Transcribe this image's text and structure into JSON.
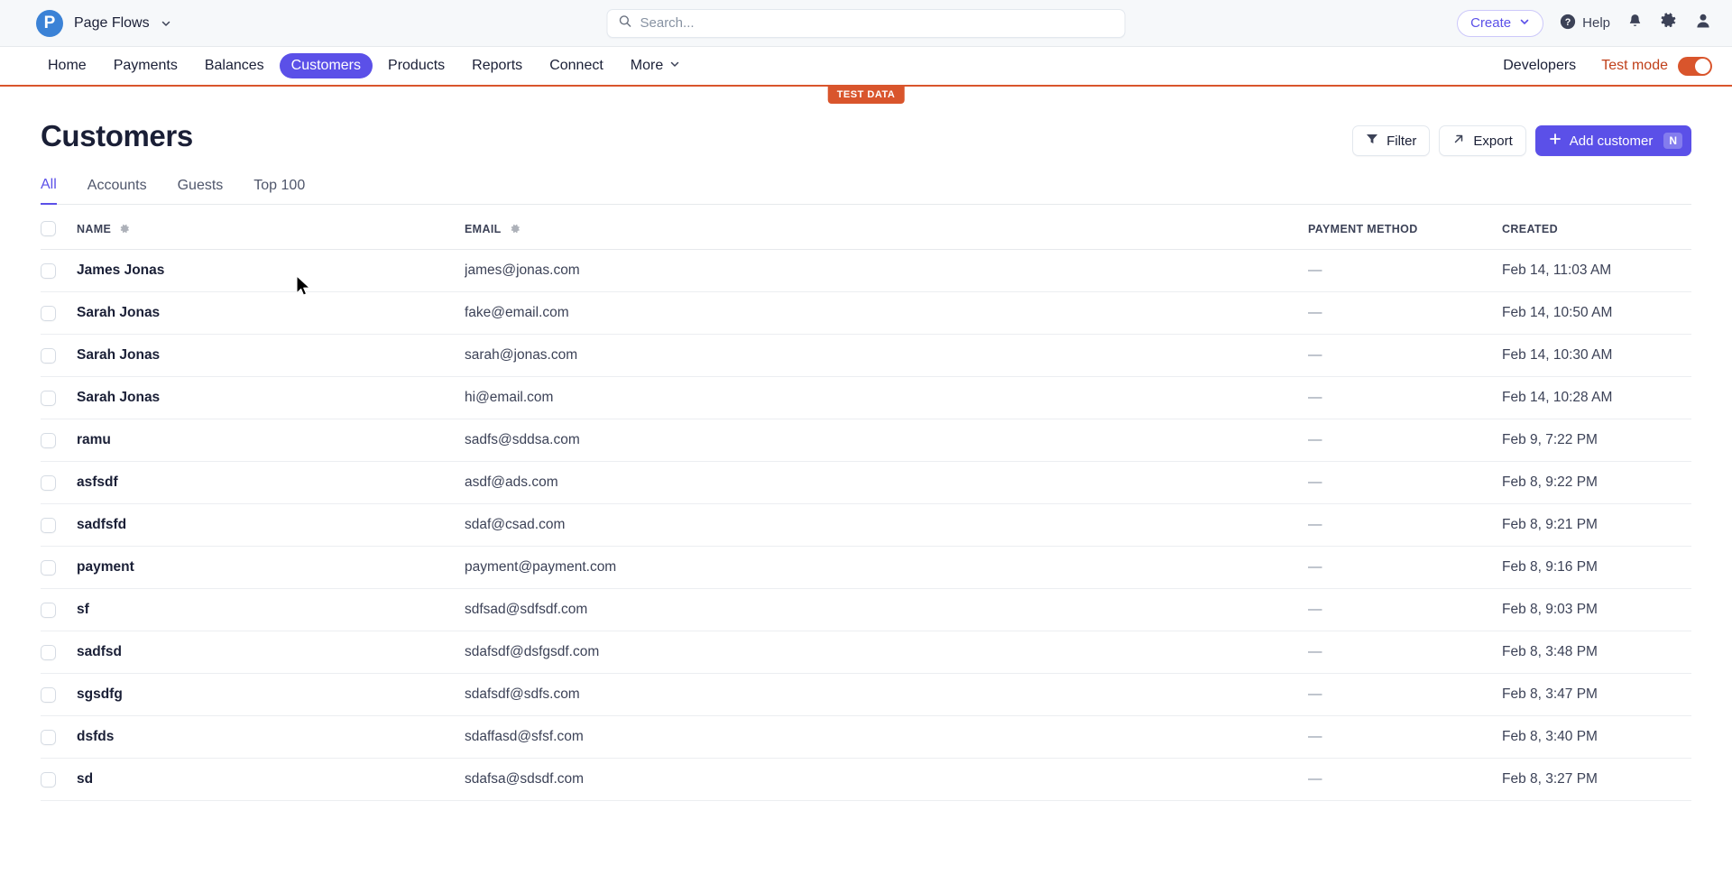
{
  "topbar": {
    "brand_name": "Page Flows",
    "brand_initial": "P",
    "search_placeholder": "Search...",
    "search_value": "",
    "create_label": "Create",
    "help_label": "Help",
    "icons": {
      "search": "search-icon",
      "chevron": "chevron-down-icon",
      "help": "help-circle-icon",
      "notifications": "bell-icon",
      "settings": "gear-icon",
      "account": "user-icon"
    }
  },
  "nav": {
    "items": [
      {
        "label": "Home",
        "active": false,
        "caret": false
      },
      {
        "label": "Payments",
        "active": false,
        "caret": false
      },
      {
        "label": "Balances",
        "active": false,
        "caret": false
      },
      {
        "label": "Customers",
        "active": true,
        "caret": false
      },
      {
        "label": "Products",
        "active": false,
        "caret": false
      },
      {
        "label": "Reports",
        "active": false,
        "caret": false
      },
      {
        "label": "Connect",
        "active": false,
        "caret": false
      },
      {
        "label": "More",
        "active": false,
        "caret": true
      }
    ],
    "developers_label": "Developers",
    "test_mode_label": "Test mode",
    "test_mode_on": true,
    "test_data_badge": "TEST DATA"
  },
  "page": {
    "title": "Customers",
    "filter_label": "Filter",
    "export_label": "Export",
    "add_label": "Add customer",
    "add_shortcut": "N"
  },
  "tabs": [
    {
      "label": "All",
      "active": true
    },
    {
      "label": "Accounts",
      "active": false
    },
    {
      "label": "Guests",
      "active": false
    },
    {
      "label": "Top 100",
      "active": false
    }
  ],
  "table": {
    "columns": [
      {
        "label": "NAME",
        "gear": true
      },
      {
        "label": "EMAIL",
        "gear": true
      },
      {
        "label": "PAYMENT METHOD",
        "gear": false
      },
      {
        "label": "CREATED",
        "gear": false
      }
    ],
    "rows": [
      {
        "name": "James Jonas",
        "email": "james@jonas.com",
        "payment_method": "—",
        "created": "Feb 14, 11:03 AM"
      },
      {
        "name": "Sarah Jonas",
        "email": "fake@email.com",
        "payment_method": "—",
        "created": "Feb 14, 10:50 AM"
      },
      {
        "name": "Sarah Jonas",
        "email": "sarah@jonas.com",
        "payment_method": "—",
        "created": "Feb 14, 10:30 AM"
      },
      {
        "name": "Sarah Jonas",
        "email": "hi@email.com",
        "payment_method": "—",
        "created": "Feb 14, 10:28 AM"
      },
      {
        "name": "ramu",
        "email": "sadfs@sddsa.com",
        "payment_method": "—",
        "created": "Feb 9, 7:22 PM"
      },
      {
        "name": "asfsdf",
        "email": "asdf@ads.com",
        "payment_method": "—",
        "created": "Feb 8, 9:22 PM"
      },
      {
        "name": "sadfsfd",
        "email": "sdaf@csad.com",
        "payment_method": "—",
        "created": "Feb 8, 9:21 PM"
      },
      {
        "name": "payment",
        "email": "payment@payment.com",
        "payment_method": "—",
        "created": "Feb 8, 9:16 PM"
      },
      {
        "name": "sf",
        "email": "sdfsad@sdfsdf.com",
        "payment_method": "—",
        "created": "Feb 8, 9:03 PM"
      },
      {
        "name": "sadfsd",
        "email": "sdafsdf@dsfgsdf.com",
        "payment_method": "—",
        "created": "Feb 8, 3:48 PM"
      },
      {
        "name": "sgsdfg",
        "email": "sdafsdf@sdfs.com",
        "payment_method": "—",
        "created": "Feb 8, 3:47 PM"
      },
      {
        "name": "dsfds",
        "email": "sdaffasd@sfsf.com",
        "payment_method": "—",
        "created": "Feb 8, 3:40 PM"
      },
      {
        "name": "sd",
        "email": "sdafsa@sdsdf.com",
        "payment_method": "—",
        "created": "Feb 8, 3:27 PM"
      }
    ]
  },
  "colors": {
    "accent": "#5b50e8",
    "test_mode": "#d9552c",
    "logo_blue": "#3b82d6",
    "text_primary": "#1a1f36",
    "text_secondary": "#4f566b"
  }
}
